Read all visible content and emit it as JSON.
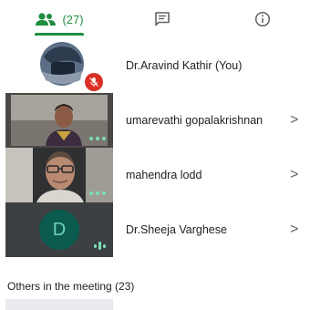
{
  "tabs": {
    "people_count": "(27)",
    "active": "people",
    "accent": "#1e8e3e"
  },
  "participants": [
    {
      "name": "Dr.Aravind Kathir (You)",
      "muted": true,
      "has_chevron": false,
      "tile": "self-video"
    },
    {
      "name": "umarevathi gopalakrishnan",
      "muted": false,
      "has_chevron": true,
      "tile": "video"
    },
    {
      "name": "mahendra lodd",
      "muted": false,
      "has_chevron": true,
      "tile": "video"
    },
    {
      "name": "Dr.Sheeja Varghese",
      "muted": false,
      "has_chevron": true,
      "tile": "avatar",
      "avatar_letter": "D",
      "speaking": true
    }
  ],
  "others_label": "Others in the meeting (23)",
  "chevron": ">"
}
